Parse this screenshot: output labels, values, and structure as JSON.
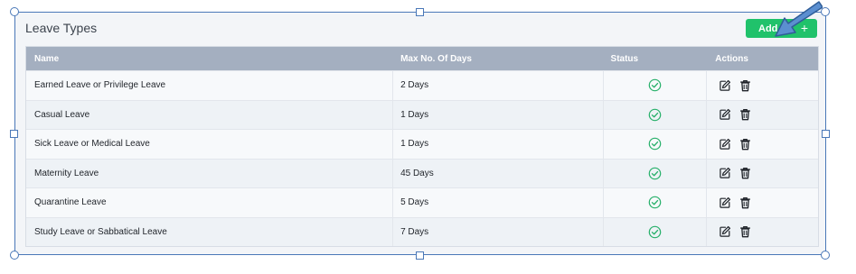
{
  "card": {
    "title": "Leave Types"
  },
  "add_button": {
    "label": "Add",
    "icon": "plus-icon"
  },
  "table": {
    "headers": [
      "Name",
      "Max No. Of Days",
      "Status",
      "Actions"
    ],
    "rows": [
      {
        "name": "Earned Leave or Privilege Leave",
        "days": "2 Days"
      },
      {
        "name": "Casual Leave",
        "days": "1 Days"
      },
      {
        "name": "Sick Leave or Medical Leave",
        "days": "1 Days"
      },
      {
        "name": "Maternity Leave",
        "days": "45 Days"
      },
      {
        "name": "Quarantine Leave",
        "days": "5 Days"
      },
      {
        "name": "Study Leave or Sabbatical Leave",
        "days": "7 Days"
      }
    ],
    "status_icon": "check-circle-icon",
    "action_icons": [
      "edit-icon",
      "trash-icon"
    ]
  },
  "colors": {
    "accent": "#20c26b",
    "header_bg": "#a4afc0",
    "selection": "#4a78b8",
    "arrow": "#5b8fd0"
  }
}
